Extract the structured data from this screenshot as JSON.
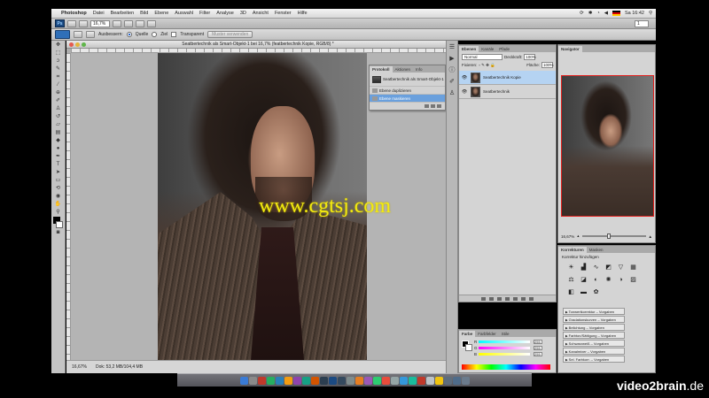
{
  "menubar": {
    "apple": "",
    "app": "Photoshop",
    "items": [
      "Datei",
      "Bearbeiten",
      "Bild",
      "Ebene",
      "Auswahl",
      "Filter",
      "Analyse",
      "3D",
      "Ansicht",
      "Fenster",
      "Hilfe"
    ],
    "clock": "Sa 16:42"
  },
  "appbar": {
    "zoom": "16,7%",
    "zoom_right": "1"
  },
  "options": {
    "mode_label": "Ausbessern:",
    "source_label": "Quelle",
    "target_label": "Ziel",
    "transparent_label": "Transparent",
    "pattern_button": "Muster verwenden"
  },
  "document": {
    "title": "Seatbertechnik als Smart-Objekt-1 bei 16,7% (featbertechnik Kopie, RGB/8) *",
    "zoom": "16,67%",
    "info": "Dok: 53,2 MB/104,4 MB",
    "watermark": "www.cgtsj.com"
  },
  "history_panel": {
    "tabs": [
      "Protokoll",
      "Aktionen",
      "Info"
    ],
    "snapshot": "Seatbertechnik als Smart-Objekt-1",
    "steps": [
      "Ebene duplizieren",
      "Ebene maskieren"
    ]
  },
  "layers_panel": {
    "tabs": [
      "Ebenen",
      "Kanäle",
      "Pfade"
    ],
    "blend_mode": "Normal",
    "opacity_label": "Deckkraft:",
    "opacity": "100%",
    "fill_label": "Fläche:",
    "fill": "100%",
    "lock_label": "Fixieren:",
    "layers": [
      {
        "name": "Seatbertechnik Kopie",
        "selected": true
      },
      {
        "name": "Seatbertechnik",
        "selected": false
      }
    ]
  },
  "color_panel": {
    "tabs": [
      "Farbe",
      "Farbfelder",
      "Stile"
    ],
    "sliders": [
      {
        "label": "R",
        "value": "255"
      },
      {
        "label": "G",
        "value": "255"
      },
      {
        "label": "B",
        "value": "255"
      }
    ]
  },
  "navigator_panel": {
    "tab": "Navigator",
    "zoom": "16,67%"
  },
  "adjust_panel": {
    "tabs": [
      "Korrekturen",
      "Masken"
    ],
    "header": "Korrektur hinzufügen",
    "presets": [
      "Tonwertkorrektur – Vorgaben",
      "Gradationskurven – Vorgaben",
      "Belichtung – Vorgaben",
      "Farbton/Sättigung – Vorgaben",
      "Schwarzweiß – Vorgaben",
      "Kanalmixer – Vorgaben",
      "Sel. Farbkorr. – Vorgaben"
    ]
  },
  "brand": {
    "name": "video2brain",
    "tld": ".de"
  },
  "colors": {
    "accent_blue": "#6aa0dd",
    "watermark_yellow": "#f3ea10",
    "navigator_frame": "#e0201d"
  }
}
